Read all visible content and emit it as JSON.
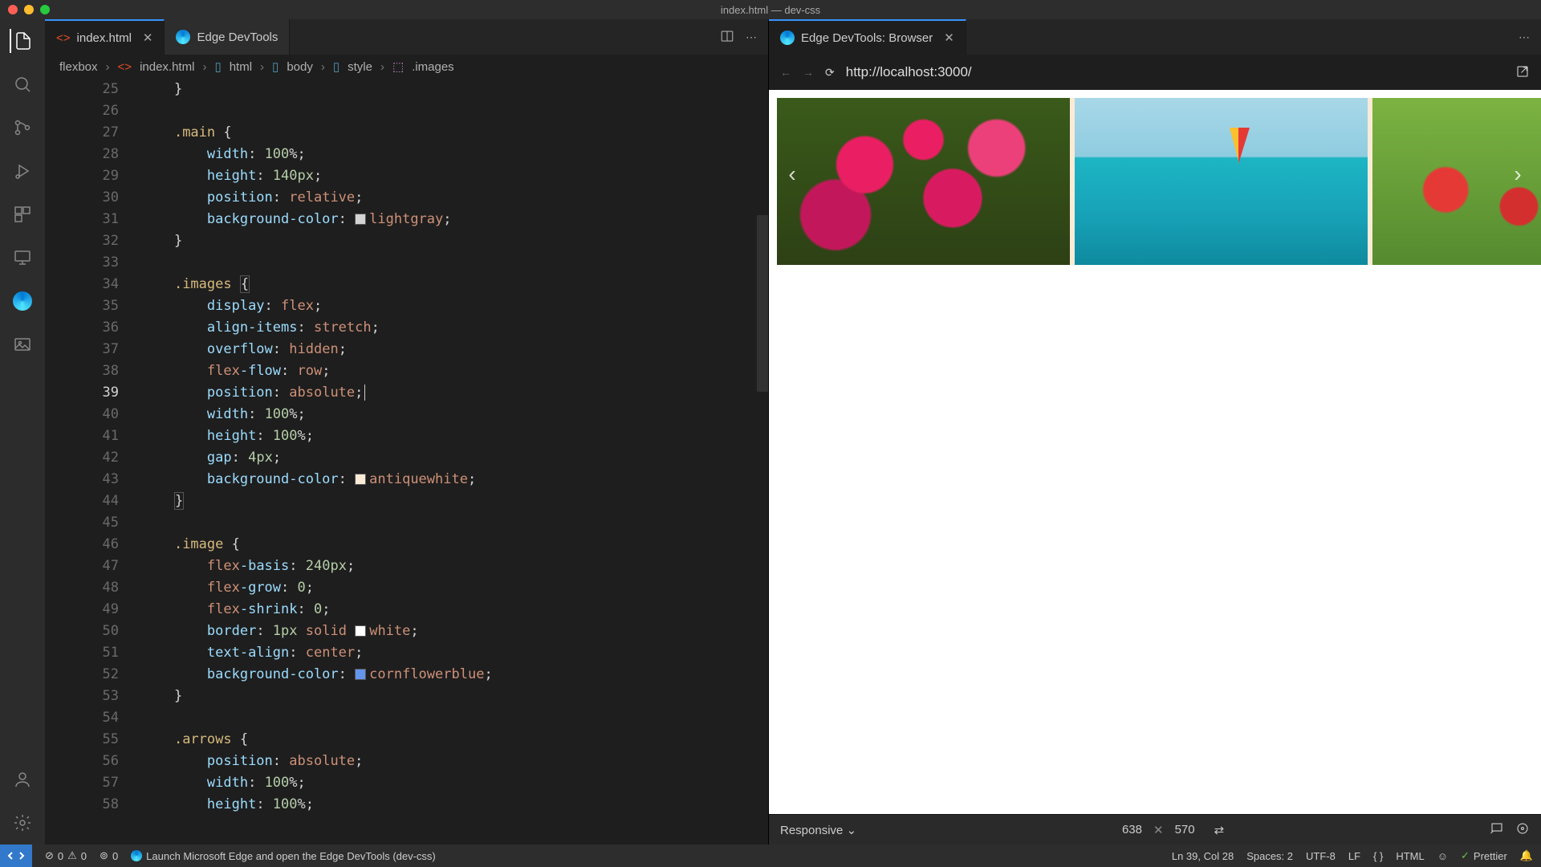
{
  "window": {
    "title": "index.html — dev-css"
  },
  "tabs": [
    {
      "label": "index.html",
      "icon": "html5-icon",
      "active": true,
      "dirty": false
    },
    {
      "label": "Edge DevTools",
      "icon": "edge-icon",
      "active": false
    }
  ],
  "breadcrumbs": [
    "flexbox",
    "index.html",
    "html",
    "body",
    "style",
    ".images"
  ],
  "code": {
    "first_line": 25,
    "active_line": 39,
    "lines": [
      "    }",
      "",
      "    .main {",
      "        width: 100%;",
      "        height: 140px;",
      "        position: relative;",
      "        background-color: ▢lightgray;",
      "    }",
      "",
      "    .images {",
      "        display: flex;",
      "        align-items: stretch;",
      "        overflow: hidden;",
      "        flex-flow: row;",
      "        position: absolute;|",
      "        width: 100%;",
      "        height: 100%;",
      "        gap: 4px;",
      "        background-color: ▢antiquewhite;",
      "    }",
      "",
      "    .image {",
      "        flex-basis: 240px;",
      "        flex-grow: 0;",
      "        flex-shrink: 0;",
      "        border: 1px solid ▢white;",
      "        text-align: center;",
      "        background-color: ▢cornflowerblue;",
      "    }",
      "",
      "    .arrows {",
      "        position: absolute;",
      "        width: 100%;",
      "        height: 100%;"
    ]
  },
  "browser": {
    "tab_label": "Edge DevTools: Browser",
    "url": "http://localhost:3000/",
    "device": {
      "mode": "Responsive",
      "width": "638",
      "height": "570"
    }
  },
  "status": {
    "errors": "0",
    "warnings": "0",
    "ports": "0",
    "launch_msg": "Launch Microsoft Edge and open the Edge DevTools (dev-css)",
    "cursor": "Ln 39, Col 28",
    "spaces": "Spaces: 2",
    "encoding": "UTF-8",
    "eol": "LF",
    "language": "HTML",
    "formatter": "Prettier"
  }
}
